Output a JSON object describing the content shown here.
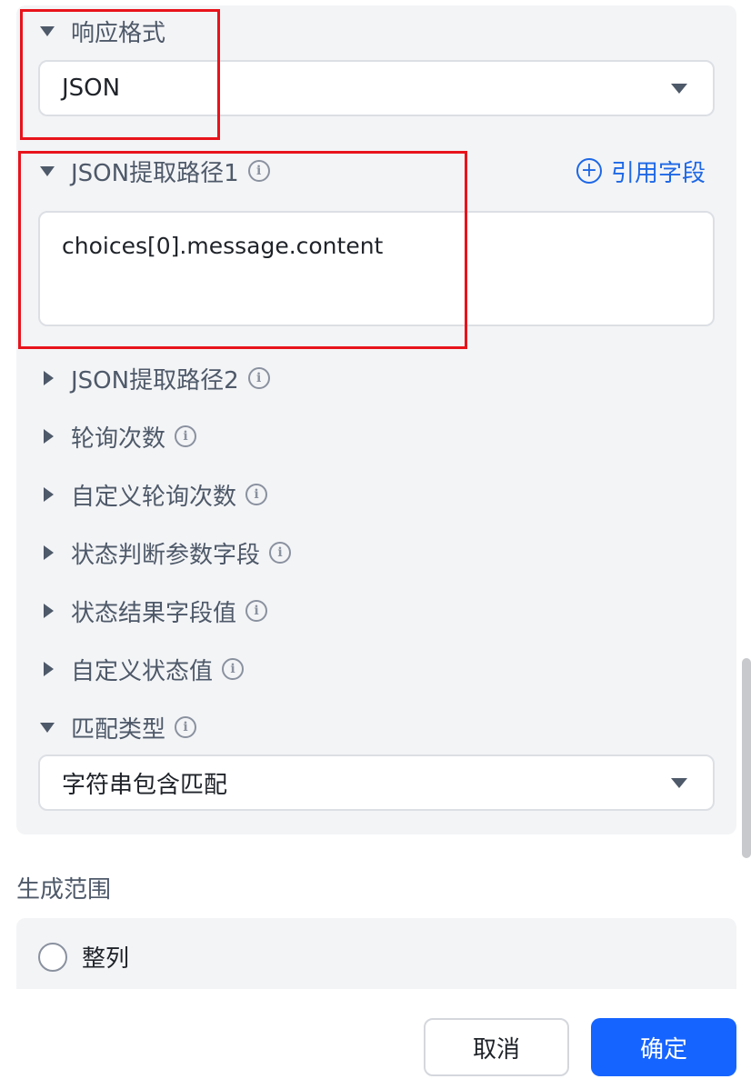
{
  "response_format": {
    "label": "响应格式",
    "value": "JSON"
  },
  "json_path_1": {
    "label": "JSON提取路径1",
    "value": "choices[0].message.content",
    "ref_link": "引用字段"
  },
  "collapsed_sections": [
    {
      "label": "JSON提取路径2"
    },
    {
      "label": "轮询次数"
    },
    {
      "label": "自定义轮询次数"
    },
    {
      "label": "状态判断参数字段"
    },
    {
      "label": "状态结果字段值"
    },
    {
      "label": "自定义状态值"
    }
  ],
  "match_type": {
    "label": "匹配类型",
    "value": "字符串包含匹配"
  },
  "generation_range": {
    "title": "生成范围",
    "options": [
      {
        "label": "整列",
        "selected": false
      }
    ]
  },
  "buttons": {
    "cancel": "取消",
    "confirm": "确定"
  },
  "icons": {
    "info": "i",
    "plus": "+"
  },
  "colors": {
    "accent": "#1664ff",
    "link": "#1d67e6",
    "highlight_box": "#e8131b",
    "panel_bg": "#f3f4f6"
  }
}
